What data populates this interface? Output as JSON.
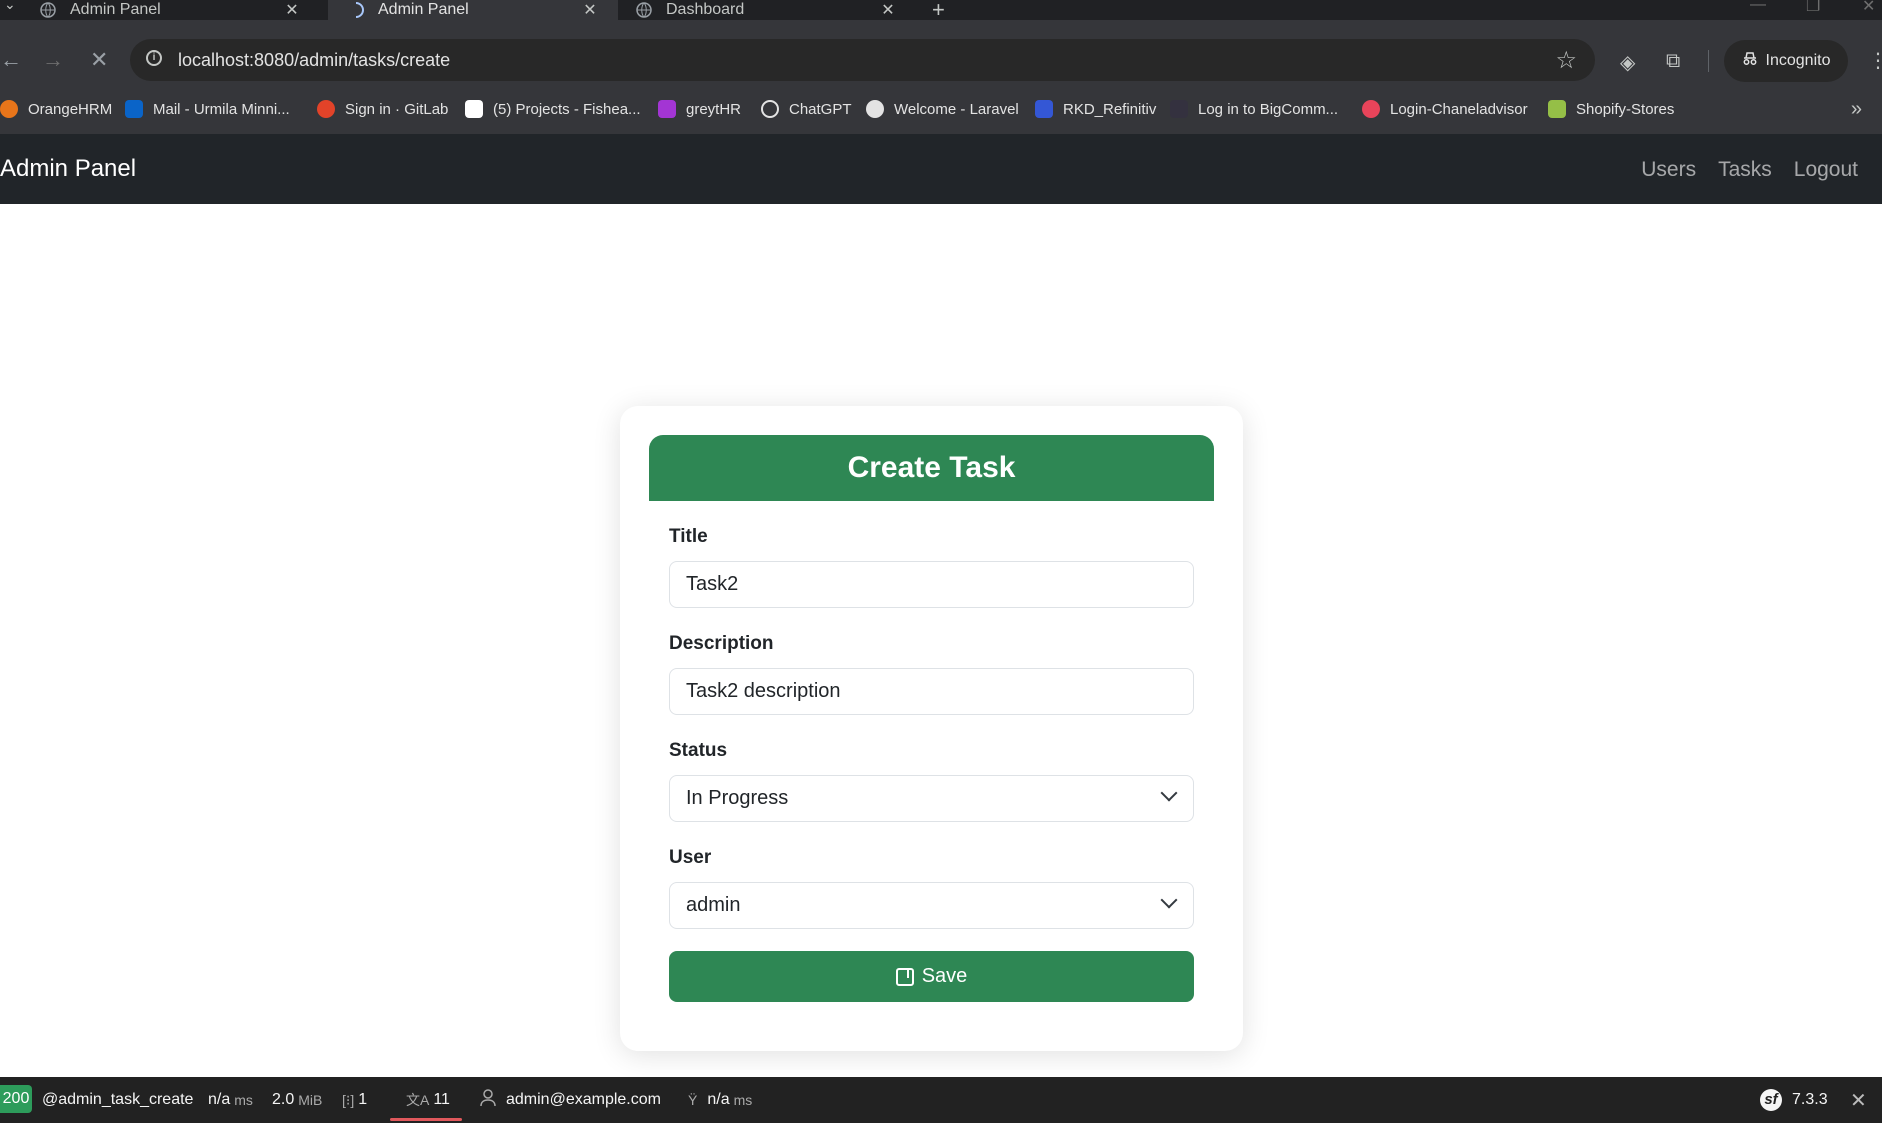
{
  "browser": {
    "tabs": [
      {
        "title": "Admin Panel",
        "active": false
      },
      {
        "title": "Admin Panel",
        "active": true
      },
      {
        "title": "Dashboard",
        "active": false
      }
    ],
    "url": "localhost:8080/admin/tasks/create",
    "incognito_label": "Incognito",
    "bookmarks": [
      {
        "label": "OrangeHRM",
        "color": "#e8751a"
      },
      {
        "label": "Mail - Urmila Minni...",
        "color": "#0a64c8"
      },
      {
        "label": "Sign in · GitLab",
        "color": "#e24329"
      },
      {
        "label": "(5) Projects - Fishea...",
        "color": "#ffffff"
      },
      {
        "label": "greytHR",
        "color": "#a335d4"
      },
      {
        "label": "ChatGPT",
        "color": "#e3e3e3"
      },
      {
        "label": "Welcome - Laravel",
        "color": "#e3e3e3"
      },
      {
        "label": "RKD_Refinitiv",
        "color": "#3457d5"
      },
      {
        "label": "Log in to BigComm...",
        "color": "#34313f"
      },
      {
        "label": "Login-Chaneladvisor",
        "color": "#e8445a"
      },
      {
        "label": "Shopify-Stores",
        "color": "#95bf47"
      }
    ]
  },
  "navbar": {
    "brand": "Admin Panel",
    "links": [
      "Users",
      "Tasks",
      "Logout"
    ]
  },
  "form": {
    "heading": "Create Task",
    "title_label": "Title",
    "title_value": "Task2",
    "description_label": "Description",
    "description_value": "Task2 description",
    "status_label": "Status",
    "status_value": "In Progress",
    "user_label": "User",
    "user_value": "admin",
    "save_label": "Save"
  },
  "debug_toolbar": {
    "status_code": "200",
    "route": "@admin_task_create",
    "time_value": "n/a",
    "time_unit": "ms",
    "memory_value": "2.0",
    "memory_unit": "MiB",
    "forms_count": "1",
    "translations_count": "11",
    "user": "admin@example.com",
    "twig_value": "n/a",
    "twig_unit": "ms",
    "version": "7.3.3",
    "accent_color": "#2d9c5b"
  },
  "colors": {
    "primary_green": "#2e8754",
    "navbar_bg": "#212529"
  }
}
